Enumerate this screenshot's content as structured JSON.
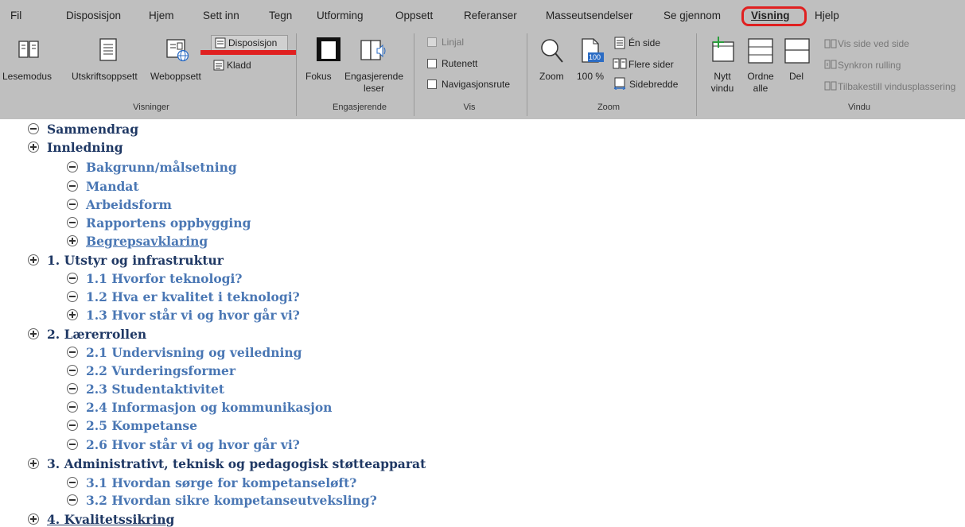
{
  "tabs": [
    "Fil",
    "Disposisjon",
    "Hjem",
    "Sett inn",
    "Tegn",
    "Utforming",
    "Oppsett",
    "Referanser",
    "Masseutsendelser",
    "Se gjennom",
    "Visning",
    "Hjelp"
  ],
  "active_tab": "Visning",
  "ribbon": {
    "visninger": {
      "label": "Visninger",
      "lesemodus": "Lesemodus",
      "utskriftsoppsett": "Utskriftsoppsett",
      "weboppsett": "Weboppsett",
      "disposisjon": "Disposisjon",
      "kladd": "Kladd"
    },
    "engasjerende": {
      "label": "Engasjerende",
      "fokus": "Fokus",
      "leser_line1": "Engasjerende",
      "leser_line2": "leser"
    },
    "vis": {
      "label": "Vis",
      "linjal": "Linjal",
      "rutenett": "Rutenett",
      "navigasjonsrute": "Navigasjonsrute"
    },
    "zoom": {
      "label": "Zoom",
      "zoom": "Zoom",
      "hundre": "100 %",
      "en_side": "Én side",
      "flere_sider": "Flere sider",
      "sidebredde": "Sidebredde",
      "icon_badge": "100"
    },
    "vindu": {
      "label": "Vindu",
      "nytt_1": "Nytt",
      "nytt_2": "vindu",
      "ordne_1": "Ordne",
      "ordne_2": "alle",
      "del": "Del",
      "vis_side": "Vis side ved side",
      "synkron": "Synkron rulling",
      "tilbakestill": "Tilbakestill vindusplassering"
    }
  },
  "outline": [
    {
      "text": "Sammendrag",
      "level": 1,
      "sym": "minus"
    },
    {
      "text": "Innledning",
      "level": 1,
      "sym": "plus"
    },
    {
      "text": "Bakgrunn/målsetning",
      "level": 2,
      "sym": "minus"
    },
    {
      "text": "Mandat",
      "level": 2,
      "sym": "minus"
    },
    {
      "text": "Arbeidsform",
      "level": 2,
      "sym": "minus"
    },
    {
      "text": "Rapportens oppbygging",
      "level": 2,
      "sym": "minus"
    },
    {
      "text": "Begrepsavklaring",
      "level": 2,
      "sym": "plus"
    },
    {
      "text": "1. Utstyr og infrastruktur",
      "level": 1,
      "sym": "plus"
    },
    {
      "text": "1.1 Hvorfor teknologi?",
      "level": 2,
      "sym": "minus"
    },
    {
      "text": "1.2 Hva er kvalitet i teknologi?",
      "level": 2,
      "sym": "minus"
    },
    {
      "text": "1.3 Hvor står vi og hvor går vi?",
      "level": 2,
      "sym": "plus"
    },
    {
      "text": "2. Lærerrollen",
      "level": 1,
      "sym": "plus"
    },
    {
      "text": "2.1 Undervisning og veiledning",
      "level": 2,
      "sym": "minus"
    },
    {
      "text": "2.2 Vurderingsformer",
      "level": 2,
      "sym": "minus"
    },
    {
      "text": "2.3 Studentaktivitet",
      "level": 2,
      "sym": "minus"
    },
    {
      "text": "2.4 Informasjon og kommunikasjon",
      "level": 2,
      "sym": "minus"
    },
    {
      "text": "2.5 Kompetanse",
      "level": 2,
      "sym": "minus"
    },
    {
      "text": "2.6 Hvor står vi og hvor går vi?",
      "level": 2,
      "sym": "minus"
    },
    {
      "text": "3. Administrativt, teknisk og pedagogisk støtteapparat",
      "level": 1,
      "sym": "plus"
    },
    {
      "text": "3.1 Hvordan sørge for kompetanseløft?",
      "level": 2,
      "sym": "minus"
    },
    {
      "text": "3.2 Hvordan sikre kompetanseutveksling?",
      "level": 2,
      "sym": "minus"
    },
    {
      "text": "4. Kvalitetssikring",
      "level": 1,
      "sym": "plus"
    }
  ]
}
